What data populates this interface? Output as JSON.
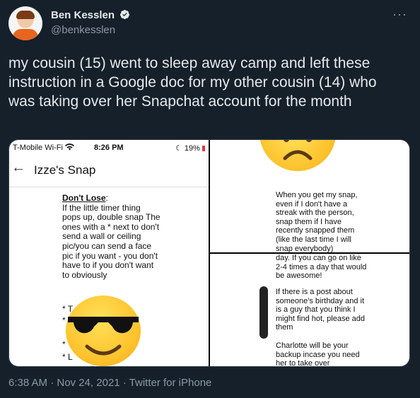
{
  "author": {
    "name": "Ben Kesslen",
    "handle": "@benkesslen"
  },
  "tweet": {
    "text": "my cousin (15) went to sleep away camp and left these instruction in a Google doc for my other cousin (14) who was taking over her Snapchat account for the month",
    "meta": "6:38 AM · Nov 24, 2021 · Twitter for iPhone"
  },
  "screenshot_left": {
    "carrier": "T-Mobile Wi-Fi ",
    "time": "8:26 PM",
    "battery": "19%",
    "title": "Izze's Snap",
    "heading": "Don't Lose",
    "heading_colon": ":",
    "body": "If the little timer thing pops up, double snap The ones with a * next to don't send a wall or ceiling pic/you can send a face pic if you want - you don't have to if you don't want to obviously",
    "bullets": [
      "* T",
      "*",
      "*",
      "* L"
    ]
  },
  "screenshot_right_top": {
    "text": "When you get my snap, even if I don't have a streak with the person, snap them if I have recently snapped them (like the last time I will snap everybody)"
  },
  "screenshot_right_bottom": {
    "text1": "day. If you can go on like 2-4 times a day that would be awesome!",
    "text2": "If there is a post about someone's birthday and it is a guy that you think I might find hot, please add them",
    "text3": "Charlotte will be your backup incase you need her to take over"
  },
  "icons": {
    "verified": "verified-badge-icon",
    "more": "more-options-icon",
    "wifi": "wifi-icon",
    "moon": "moon-icon",
    "battery": "battery-icon",
    "back": "back-arrow-icon",
    "sunglasses_emoji": "sunglasses-emoji-icon",
    "angry_emoji": "angry-emoji-icon"
  },
  "colors": {
    "background": "#15202b",
    "primary_text": "#e7e9ea",
    "secondary_text": "#8b98a5",
    "verified": "#1d9bf0"
  }
}
